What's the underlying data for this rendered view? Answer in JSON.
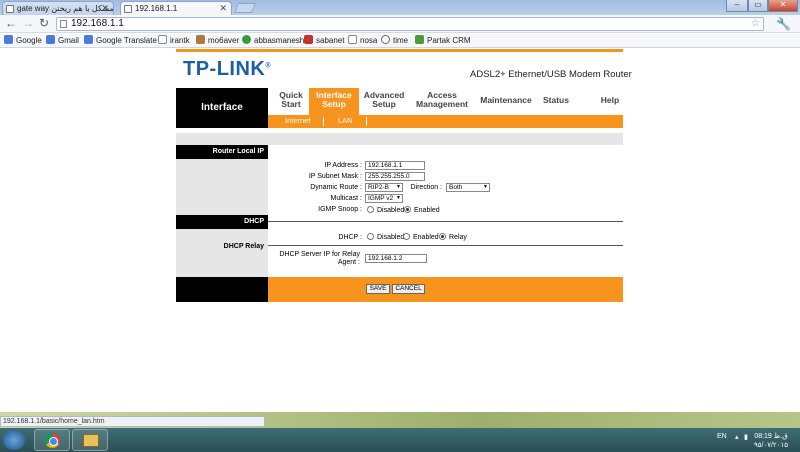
{
  "browser": {
    "tabs": [
      {
        "label": "gate way مشکل با هم ریختن",
        "active": false
      },
      {
        "label": "192.168.1.1",
        "active": true
      }
    ],
    "address": "192.168.1.1",
    "status_url": "192.168.1.1/basic/home_lan.htm",
    "bookmarks": [
      {
        "label": "Google",
        "icon": "google-icon",
        "color": "#4a7bd6"
      },
      {
        "label": "Gmail",
        "icon": "google-icon",
        "color": "#4a7bd6"
      },
      {
        "label": "Google Translate",
        "icon": "translate-icon",
        "color": "#4a7bd6"
      },
      {
        "label": "irantk",
        "icon": "page-icon",
        "color": "#888888"
      },
      {
        "label": "mo6aver",
        "icon": "person-icon",
        "color": "#b07a3c"
      },
      {
        "label": "abbasmanesh",
        "icon": "globe-icon",
        "color": "#3a9a3a"
      },
      {
        "label": "sabanet",
        "icon": "sabanet-icon",
        "color": "#c8302a"
      },
      {
        "label": "nosa",
        "icon": "page-icon",
        "color": "#888888"
      },
      {
        "label": "time",
        "icon": "clock-icon",
        "color": "#666666"
      },
      {
        "label": "Partak CRM",
        "icon": "leaf-icon",
        "color": "#4a9a3a"
      }
    ]
  },
  "router": {
    "logo": "TP-LINK",
    "model": "ADSL2+ Ethernet/USB Modem Router",
    "section": "Interface",
    "menu": [
      {
        "label": "Quick\nStart",
        "active": false
      },
      {
        "label": "Interface\nSetup",
        "active": true
      },
      {
        "label": "Advanced\nSetup",
        "active": false
      },
      {
        "label": "Access\nManagement",
        "active": false
      },
      {
        "label": "Maintenance",
        "active": false
      },
      {
        "label": "Status",
        "active": false
      },
      {
        "label": "Help",
        "active": false
      }
    ],
    "submenu": [
      "Internet",
      "LAN"
    ],
    "router_local_ip": {
      "heading": "Router Local IP",
      "ip_address_label": "IP Address :",
      "ip_address": "192.168.1.1",
      "subnet_label": "IP Subnet Mask :",
      "subnet": "255.255.255.0",
      "dynamic_route_label": "Dynamic Route :",
      "dynamic_route": "RIP2-B",
      "direction_label": "Direction :",
      "direction": "Both",
      "multicast_label": "Multicast :",
      "multicast": "IGMP v2",
      "igmp_label": "IGMP Snoop :",
      "igmp_options": [
        "Disabled",
        "Enabled"
      ],
      "igmp_selected": "Enabled"
    },
    "dhcp": {
      "heading": "DHCP",
      "relay_heading": "DHCP Relay",
      "dhcp_label": "DHCP :",
      "options": [
        "Disabled",
        "Enabled",
        "Relay"
      ],
      "selected": "Relay",
      "relay_server_label": "DHCP Server IP for Relay\nAgent :",
      "relay_server": "192.168.1.2"
    },
    "buttons": {
      "save": "SAVE",
      "cancel": "CANCEL"
    }
  },
  "taskbar": {
    "lang": "EN",
    "time": "ق.ظ 08:19",
    "date": "۹۵/۰۷/۲۰۱۵"
  }
}
